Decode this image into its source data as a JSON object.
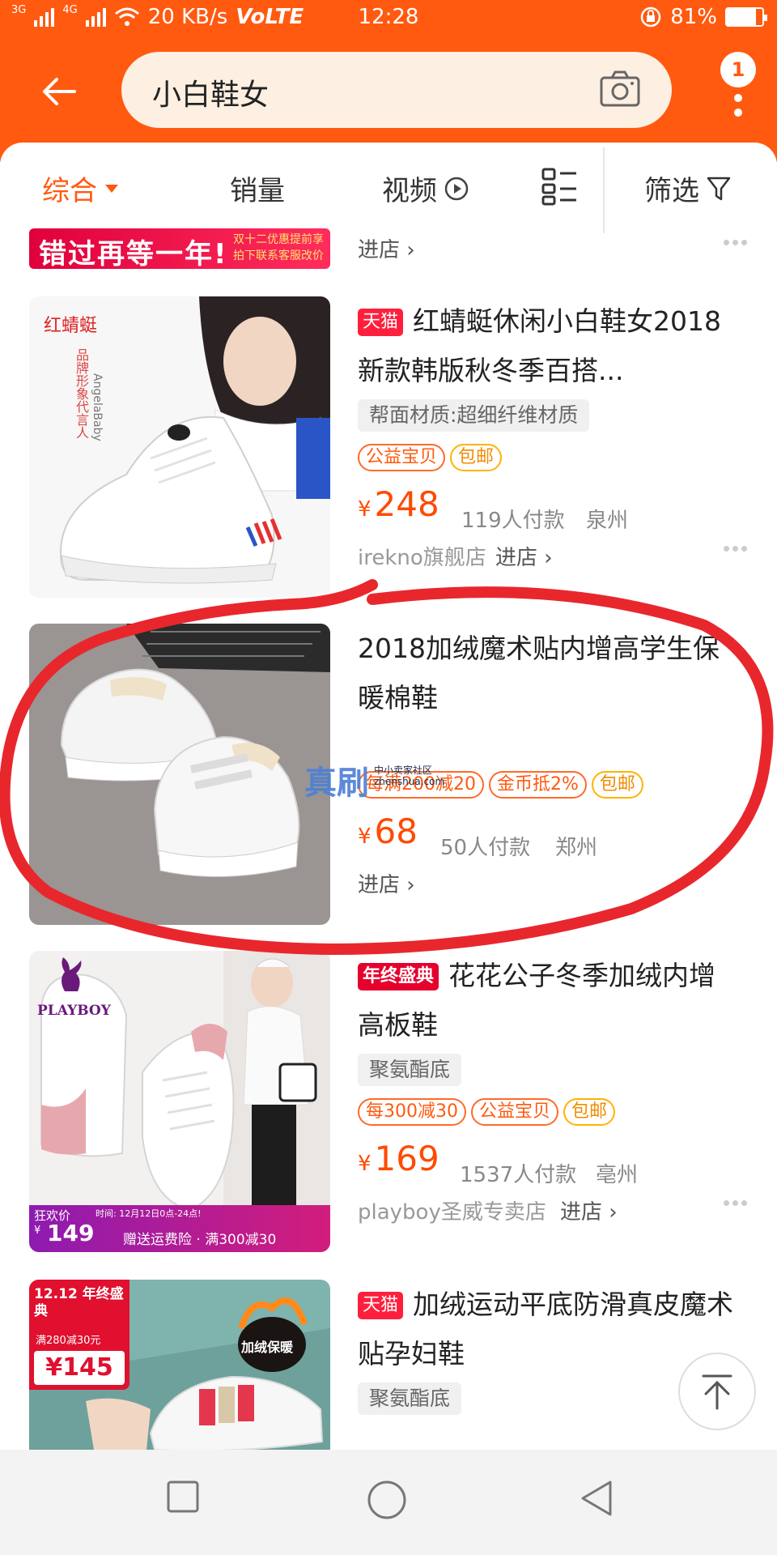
{
  "status_bar": {
    "network_left": "3G",
    "network_right": "4G",
    "speed": "20 KB/s",
    "volte": "VoLTE",
    "time": "12:28",
    "battery": "81%",
    "battery_level": 0.81
  },
  "header": {
    "search_query": "小白鞋女",
    "badge_count": "1"
  },
  "sort_tabs": [
    {
      "label": "综合",
      "active": true
    },
    {
      "label": "销量"
    },
    {
      "label": "视频"
    },
    {
      "label": "筛选"
    }
  ],
  "banner": {
    "text": "错过再等一年!",
    "small_text_1": "双十二优惠提前享",
    "small_text_2": "拍下联系客服改价"
  },
  "store_link_label": "进店",
  "products": [
    {
      "brand_tag": "天猫",
      "title": "红蜻蜓休闲小白鞋女2018新款韩版秋冬季百搭...",
      "spec": "帮面材质:超细纤维材质",
      "pills": [
        "公益宝贝",
        "包邮"
      ],
      "price": "248",
      "buyers": "119人付款",
      "location": "泉州",
      "shop": "irekno旗舰店",
      "image_labels": {
        "logo": "红蜻蜓",
        "spokes": "品牌形象代言人",
        "name": "AngelaBaby"
      }
    },
    {
      "title": "2018加绒魔术贴内增高学生保暖棉鞋",
      "pills": [
        "每满200减20",
        "金币抵2%",
        "包邮"
      ],
      "price": "68",
      "buyers": "50人付款",
      "location": "郑州"
    },
    {
      "brand_tag": "年终盛典",
      "title": "花花公子冬季加绒内增高板鞋",
      "spec": "聚氨酯底",
      "pills": [
        "每300减30",
        "公益宝贝",
        "包邮"
      ],
      "price": "169",
      "buyers": "1537人付款",
      "location": "亳州",
      "shop": "playboy圣威专卖店",
      "image_labels": {
        "brand": "PLAYBOY",
        "promo_tag": "狂欢价",
        "promo_time": "时间: 12月12日0点-24点!",
        "promo_price": "149",
        "promo_bottom": "赠送运费险 · 满300减30"
      }
    },
    {
      "brand_tag": "天猫",
      "title": "加绒运动平底防滑真皮魔术贴孕妇鞋",
      "spec": "聚氨酯底",
      "image_labels": {
        "event": "12.12 年终盛典",
        "coupon": "满280减30元",
        "promo_price": "¥145",
        "tag": "加绒保暖"
      }
    }
  ],
  "watermark": {
    "main": "真刷",
    "sub_cn": "中小卖家社区",
    "sub_en": "zhenshua.com"
  },
  "colors": {
    "brand_orange": "#ff5a10",
    "price": "#ff4a00",
    "tmall_red": "#ff1f3d",
    "annotation_red": "#e8272d"
  }
}
